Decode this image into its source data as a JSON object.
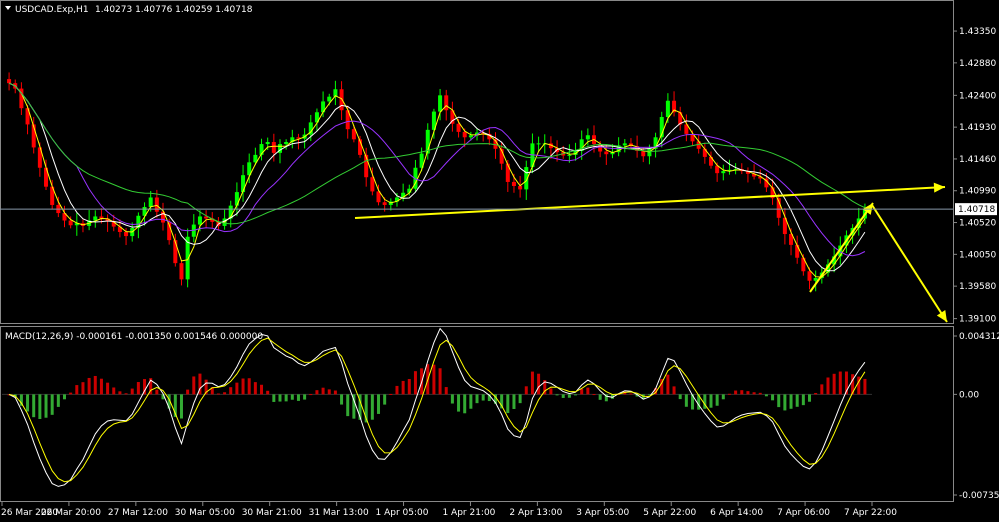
{
  "header": {
    "symbol_label": "USDCAD.Exp,H1",
    "ohlc_label": "1.40273 1.40776 1.40259 1.40718"
  },
  "macd_header": {
    "label": "MACD(12,26,9) -0.000161 -0.001350 0.001546 0.000000"
  },
  "chart_data": [
    {
      "type": "candlestick",
      "symbol": "USDCAD.Exp",
      "timeframe": "H1",
      "ohlc_current": {
        "open": 1.40273,
        "high": 1.40776,
        "low": 1.40259,
        "close": 1.40718
      },
      "price_axis_ticks": [
        "1.43350",
        "1.42880",
        "1.42400",
        "1.41930",
        "1.41460",
        "1.40990",
        "1.40520",
        "1.40050",
        "1.39580",
        "1.39100"
      ],
      "price_tick_values": [
        1.4335,
        1.4288,
        1.424,
        1.4193,
        1.4146,
        1.4099,
        1.4052,
        1.4005,
        1.3958,
        1.391
      ],
      "current_price_label": "1.40718",
      "current_price": 1.40718,
      "ylim": [
        1.3905,
        1.4375
      ],
      "time_axis_ticks": [
        "26 Mar 2020",
        "26 Mar 20:00",
        "27 Mar 12:00",
        "30 Mar 05:00",
        "30 Mar 21:00",
        "31 Mar 13:00",
        "1 Apr 05:00",
        "1 Apr 21:00",
        "2 Apr 13:00",
        "3 Apr 05:00",
        "5 Apr 22:00",
        "6 Apr 14:00",
        "7 Apr 06:00",
        "7 Apr 22:00"
      ],
      "closes": [
        1.4258,
        1.425,
        1.4221,
        1.4197,
        1.4163,
        1.4133,
        1.4105,
        1.4078,
        1.4066,
        1.4055,
        1.4048,
        1.4051,
        1.4047,
        1.4055,
        1.4061,
        1.4058,
        1.4054,
        1.4046,
        1.4038,
        1.4032,
        1.4044,
        1.4062,
        1.4075,
        1.4089,
        1.4068,
        1.4052,
        1.4026,
        1.3992,
        1.3968,
        1.4031,
        1.4049,
        1.4061,
        1.4058,
        1.4053,
        1.4047,
        1.4058,
        1.4077,
        1.4097,
        1.4122,
        1.4141,
        1.4152,
        1.4168,
        1.4171,
        1.4155,
        1.4168,
        1.4171,
        1.4178,
        1.4176,
        1.4182,
        1.42,
        1.4215,
        1.4231,
        1.4238,
        1.4249,
        1.4218,
        1.419,
        1.4175,
        1.4152,
        1.4119,
        1.4098,
        1.4082,
        1.4078,
        1.4083,
        1.4089,
        1.4096,
        1.4102,
        1.4133,
        1.4154,
        1.4189,
        1.4216,
        1.424,
        1.4218,
        1.4198,
        1.4186,
        1.4178,
        1.4181,
        1.4185,
        1.4183,
        1.4175,
        1.4161,
        1.4139,
        1.4112,
        1.4106,
        1.4101,
        1.4134,
        1.4169,
        1.4169,
        1.4169,
        1.4162,
        1.4156,
        1.4151,
        1.4152,
        1.4158,
        1.4175,
        1.4181,
        1.4168,
        1.4157,
        1.4153,
        1.4156,
        1.4166,
        1.4169,
        1.4165,
        1.4158,
        1.415,
        1.4161,
        1.4178,
        1.4208,
        1.4232,
        1.4215,
        1.4197,
        1.4183,
        1.4172,
        1.4161,
        1.4149,
        1.4136,
        1.4125,
        1.4128,
        1.413,
        1.4131,
        1.4128,
        1.4124,
        1.412,
        1.4117,
        1.4104,
        1.4088,
        1.4059,
        1.4035,
        1.4019,
        1.4,
        1.398,
        1.3966,
        1.397,
        1.3978,
        1.399,
        1.4002,
        1.4018,
        1.4033,
        1.4044,
        1.4058,
        1.4072
      ],
      "indicators": [
        "MA fast (yellow)",
        "MA medium (white)",
        "MA slow (purple)",
        "MA long (green)"
      ],
      "annotations": [
        "yellow trendline from 31 Mar 13:00 extended right with arrow",
        "yellow arrow up 7 Apr 06:00 to 7 Apr 22:00",
        "yellow arrow down after 7 Apr 22:00"
      ]
    },
    {
      "type": "macd",
      "params": "MACD(12,26,9)",
      "values": {
        "macd": -0.000161,
        "signal": -0.00135,
        "histogram": 0.001546,
        "zero": 0.0
      },
      "axis_ticks": [
        "0.004312",
        "0.00",
        "-0.007359"
      ],
      "axis_tick_values": [
        0.004312,
        0.0,
        -0.007359
      ]
    }
  ],
  "colors": {
    "background": "#000000",
    "bull_candle": "#00ff00",
    "bear_candle": "#ff0000",
    "text": "#ffffff",
    "grid": "#888888",
    "annotation": "#ffff00",
    "ma_fast": "#ffff00",
    "ma_medium": "#ffffff",
    "ma_slow": "#9933ff",
    "ma_long": "#33cc33",
    "hist_positive": "#cc0000",
    "hist_negative": "#33aa33"
  }
}
